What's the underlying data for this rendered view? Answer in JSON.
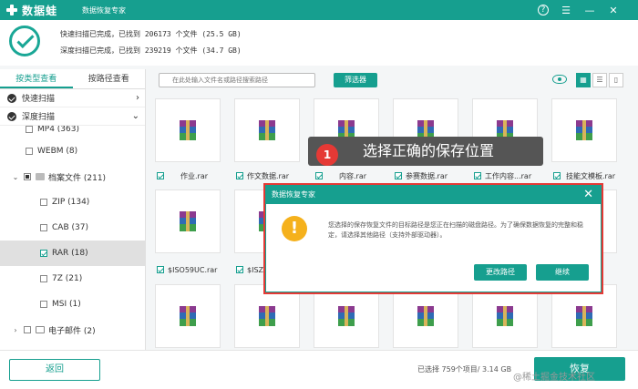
{
  "app": {
    "name": "数据蛙",
    "subtitle": "数据恢复专家",
    "help_icon": "?"
  },
  "header": {
    "quick_scan": "快速扫描已完成，已找到 206173 个文件 (25.5 GB)",
    "deep_scan": "深度扫描已完成，已找到 239219 个文件 (34.7 GB)"
  },
  "sidebar": {
    "tabs": [
      "按类型查看",
      "按路径查看"
    ],
    "scans": [
      "快速扫描",
      "深度扫描"
    ],
    "tree": [
      {
        "label": "MP4 (363)",
        "checked": false
      },
      {
        "label": "WEBM (8)",
        "checked": false
      },
      {
        "label": "档案文件 (211)",
        "checked": false
      },
      {
        "label": "ZIP (134)",
        "checked": false
      },
      {
        "label": "CAB (37)",
        "checked": false
      },
      {
        "label": "RAR (18)",
        "checked": true
      },
      {
        "label": "7Z (21)",
        "checked": false
      },
      {
        "label": "MSI (1)",
        "checked": false
      },
      {
        "label": "电子邮件 (2)",
        "checked": false
      }
    ]
  },
  "toolbar": {
    "search_placeholder": "在此处输入文件名或路径搜索路径",
    "filter_label": "筛选器"
  },
  "files_row1": [
    "作业.rar",
    "作文数据.rar",
    "内容.rar",
    "参赛数据.rar",
    "工作内容...rar",
    "技能文模板.rar"
  ],
  "files_row2": [
    "$ISO59UC.rar",
    "$ISZ"
  ],
  "callout": {
    "number": "1",
    "text": "选择正确的保存位置"
  },
  "dialog": {
    "title": "数据恢复专家",
    "message": "您选择的保存恢复文件的目标路径是您正在扫描的磁盘路径。为了确保数据恢复的完整和稳定，请选择其他路径（支持外部驱动器）。",
    "warn_icon": "!",
    "change_path": "更改路径",
    "continue": "继续"
  },
  "footer": {
    "back": "返回",
    "status": "已选择 759个项目/ 3.14 GB",
    "recover": "恢复",
    "watermark": "@稀土掘金技术社区"
  }
}
